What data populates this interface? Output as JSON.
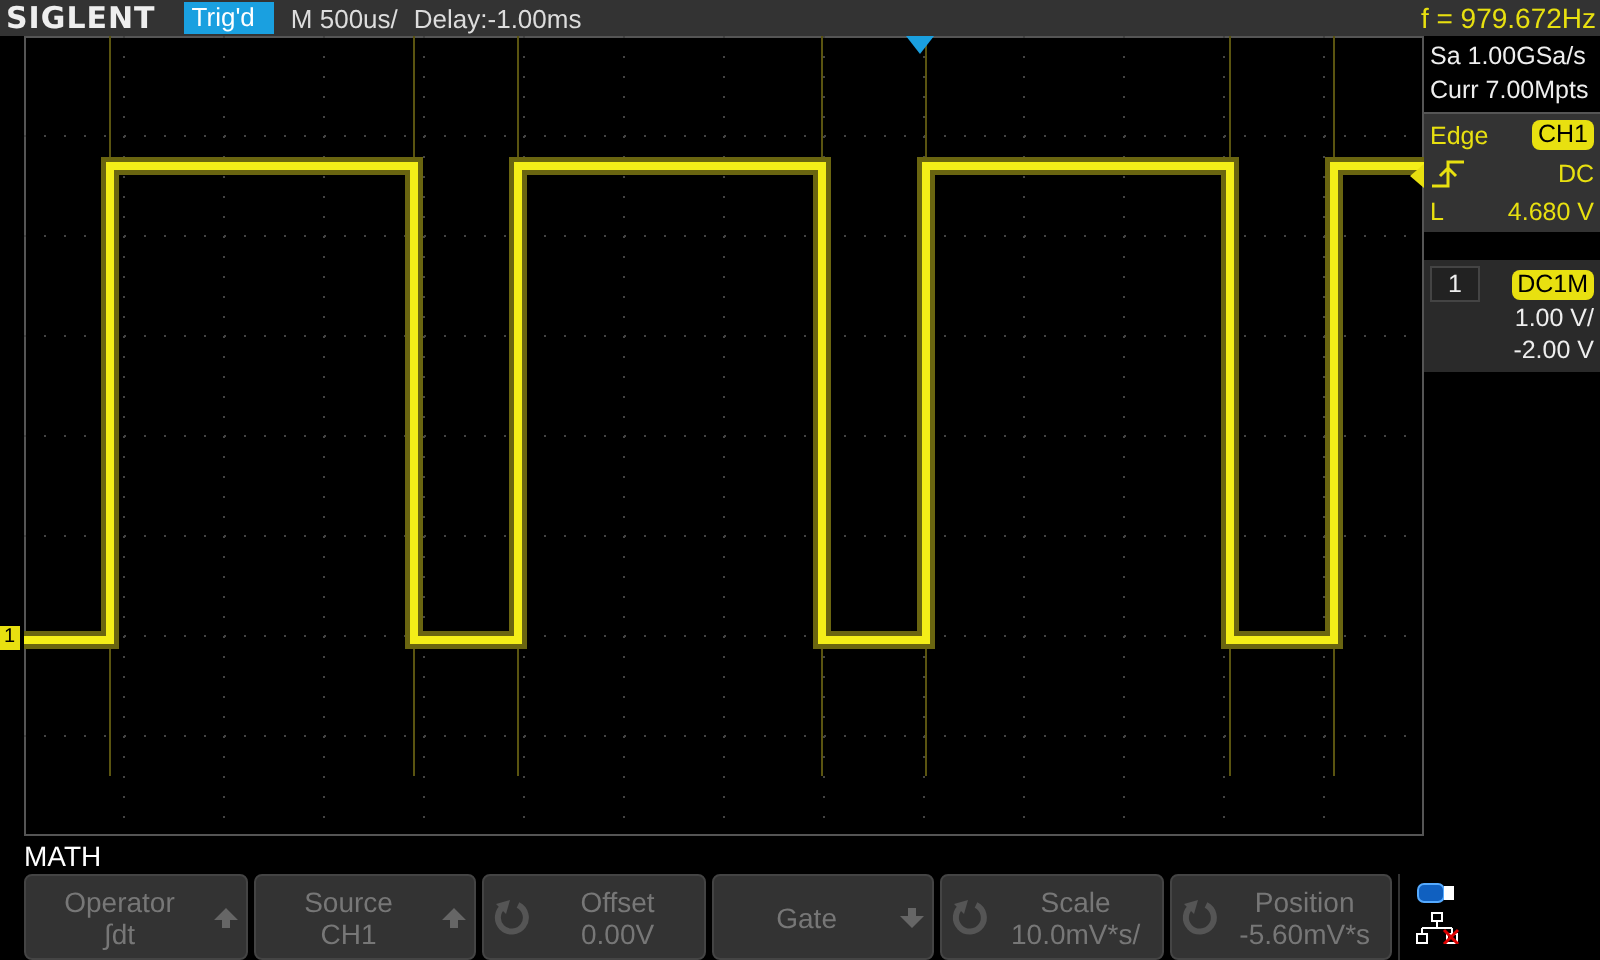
{
  "brand": "SIGLENT",
  "status": {
    "trigger_state": "Trig'd",
    "timebase": "M 500us/",
    "delay": "Delay:-1.00ms",
    "frequency": "f = 979.672Hz"
  },
  "channel_marker": "1",
  "acquisition": {
    "sample_rate": "Sa 1.00GSa/s",
    "memory_depth": "Curr 7.00Mpts"
  },
  "trigger": {
    "type": "Edge",
    "source": "CH1",
    "coupling": "DC",
    "level_label": "L",
    "level_value": "4.680 V"
  },
  "channel": {
    "number": "1",
    "coupling": "DC1M",
    "scale": "1.00 V/",
    "offset": "-2.00 V"
  },
  "menu_title": "MATH",
  "softkeys": [
    {
      "label": "Operator",
      "value": "∫dt",
      "kind": "up"
    },
    {
      "label": "Source",
      "value": "CH1",
      "kind": "up"
    },
    {
      "label": "Offset",
      "value": "0.00V",
      "kind": "knob"
    },
    {
      "label": "Gate",
      "kind": "down"
    },
    {
      "label": "Scale",
      "value": "10.0mV*s/",
      "kind": "knob"
    },
    {
      "label": "Position",
      "value": "-5.60mV*s",
      "kind": "knob"
    }
  ]
}
